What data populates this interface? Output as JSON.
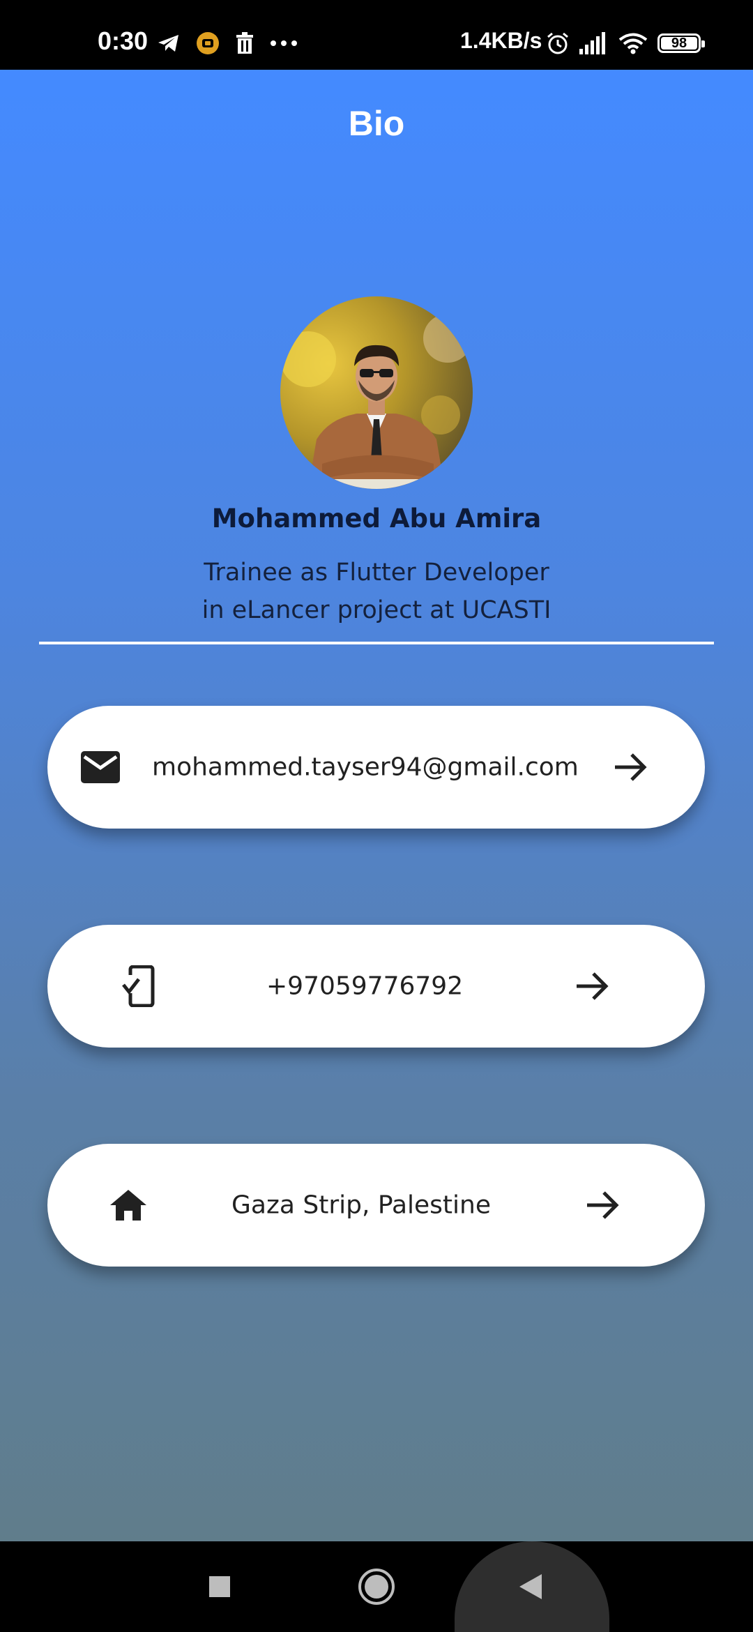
{
  "status_bar": {
    "time": "0:30",
    "network_speed": "1.4KB/s",
    "battery_level": "98",
    "icons": [
      "telegram-icon",
      "notification-icon",
      "trash-icon",
      "more-dots-icon",
      "alarm-icon",
      "signal-icon",
      "wifi-icon",
      "battery-icon"
    ]
  },
  "app": {
    "title": "Bio",
    "background_gradient": [
      "#448aff",
      "#607d8b"
    ]
  },
  "profile": {
    "name": "Mohammed Abu Amira",
    "title_line1": "Trainee as Flutter Developer",
    "title_line2": "in eLancer project at UCASTI"
  },
  "contacts": [
    {
      "icon": "email-icon",
      "label": "mohammed.tayser94@gmail.com",
      "action_icon": "arrow-forward-icon"
    },
    {
      "icon": "phone-check-icon",
      "label": "+97059776792",
      "action_icon": "arrow-forward-icon"
    },
    {
      "icon": "home-icon",
      "label": "Gaza Strip, Palestine",
      "action_icon": "arrow-forward-icon"
    }
  ],
  "nav_bar": {
    "buttons": [
      "recent-apps-icon",
      "home-circle-icon",
      "back-icon"
    ]
  }
}
